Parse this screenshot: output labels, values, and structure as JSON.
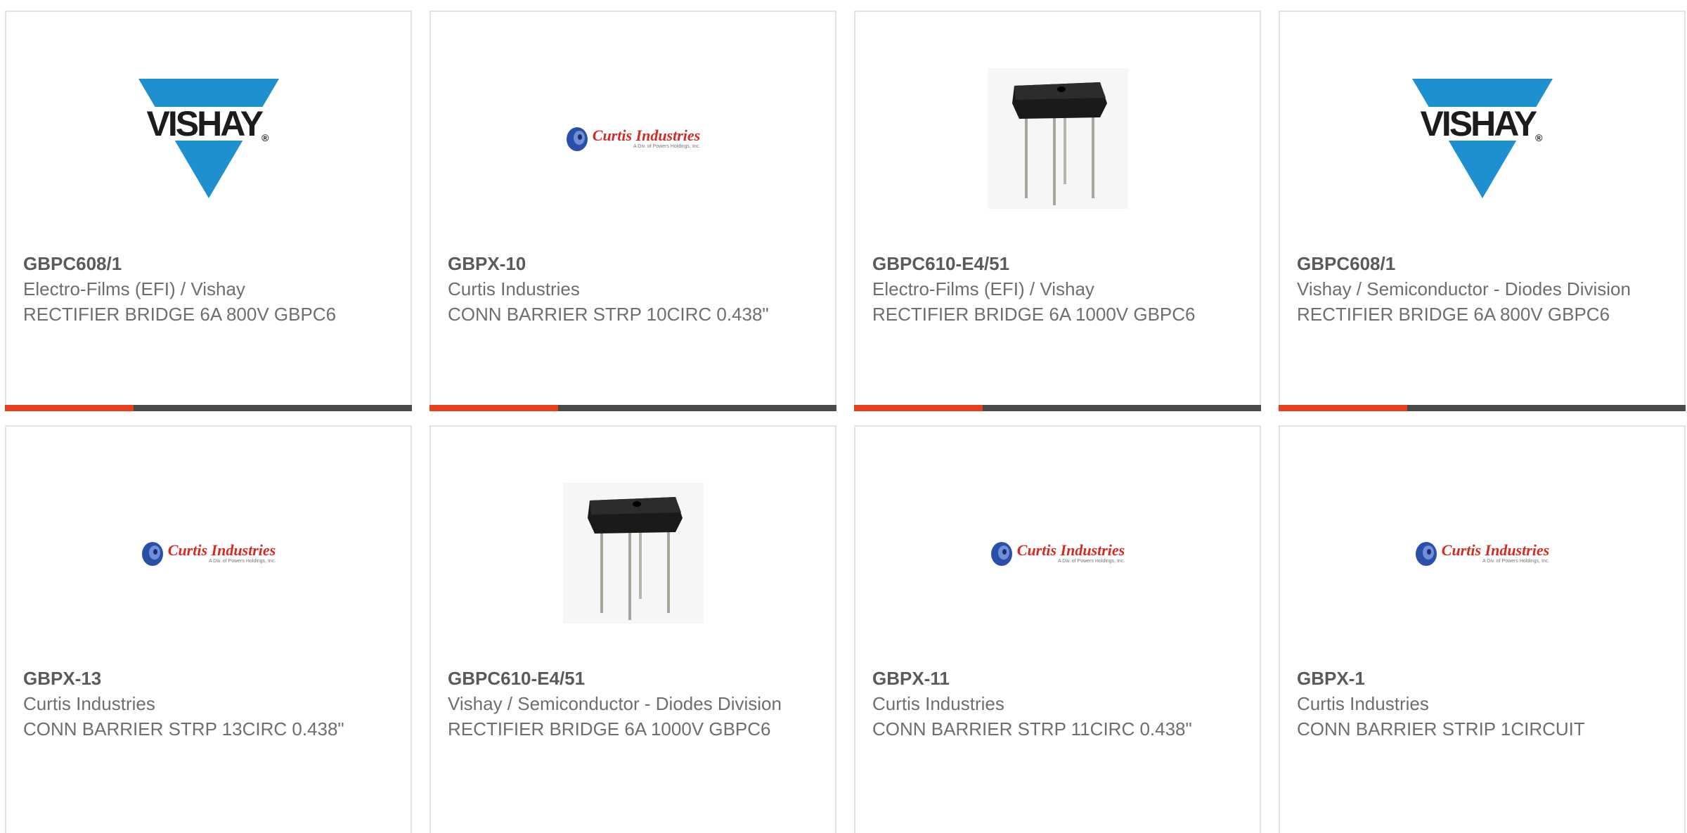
{
  "colors": {
    "accent": "#e8401c",
    "bar": "#4a4a4a",
    "vishay_blue": "#1e8fcf",
    "curtis_red": "#d42a24",
    "curtis_blue": "#2a4fa8"
  },
  "products": [
    {
      "part_number": "GBPC608/1",
      "manufacturer": "Electro-Films (EFI) / Vishay",
      "description": "RECTIFIER BRIDGE 6A 800V GBPC6",
      "image": "vishay-logo"
    },
    {
      "part_number": "GBPX-10",
      "manufacturer": "Curtis Industries",
      "description": "CONN BARRIER STRP 10CIRC 0.438\"",
      "image": "curtis-logo"
    },
    {
      "part_number": "GBPC610-E4/51",
      "manufacturer": "Electro-Films (EFI) / Vishay",
      "description": "RECTIFIER BRIDGE 6A 1000V GBPC6",
      "image": "bridge-rectifier-photo"
    },
    {
      "part_number": "GBPC608/1",
      "manufacturer": "Vishay / Semiconductor - Diodes Division",
      "description": "RECTIFIER BRIDGE 6A 800V GBPC6",
      "image": "vishay-logo"
    },
    {
      "part_number": "GBPX-13",
      "manufacturer": "Curtis Industries",
      "description": "CONN BARRIER STRP 13CIRC 0.438\"",
      "image": "curtis-logo"
    },
    {
      "part_number": "GBPC610-E4/51",
      "manufacturer": "Vishay / Semiconductor - Diodes Division",
      "description": "RECTIFIER BRIDGE 6A 1000V GBPC6",
      "image": "bridge-rectifier-photo"
    },
    {
      "part_number": "GBPX-11",
      "manufacturer": "Curtis Industries",
      "description": "CONN BARRIER STRP 11CIRC 0.438\"",
      "image": "curtis-logo"
    },
    {
      "part_number": "GBPX-1",
      "manufacturer": "Curtis Industries",
      "description": "CONN BARRIER STRIP 1CIRCUIT",
      "image": "curtis-logo"
    }
  ],
  "logos": {
    "vishay_text": "VISHAY",
    "vishay_reg": "®",
    "curtis_text": "Curtis Industries",
    "curtis_sub": "A Div. of Powers Holdings, Inc."
  }
}
